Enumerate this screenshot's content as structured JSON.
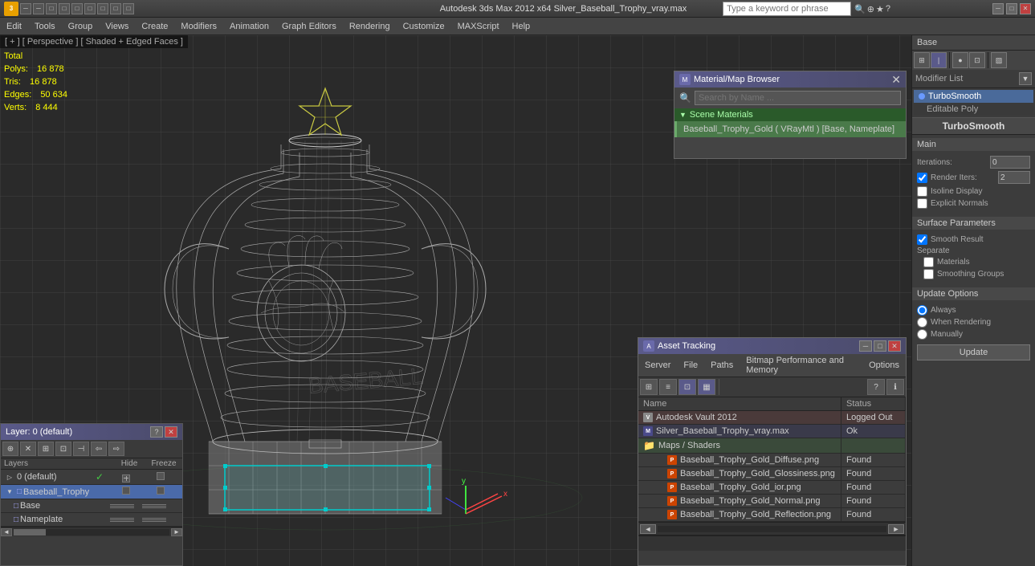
{
  "window": {
    "title": "Autodesk 3ds Max  2012 x64    Silver_Baseball_Trophy_vray.max",
    "app_icon": "3",
    "search_placeholder": "Type a keyword or phrase",
    "min_btn": "─",
    "max_btn": "□",
    "close_btn": "✕"
  },
  "titlebar": {
    "left_buttons": [
      "─",
      "─",
      "□",
      "□",
      "□",
      "□",
      "□",
      "□",
      "□"
    ]
  },
  "menubar": {
    "items": [
      "Edit",
      "Tools",
      "Group",
      "Views",
      "Create",
      "Modifiers",
      "Animation",
      "Graph Editors",
      "Rendering",
      "Customize",
      "MAXScript",
      "Help"
    ]
  },
  "viewport": {
    "label": "[ + ] [ Perspective ] [ Shaded + Edged Faces ]",
    "stats": {
      "total_label": "Total",
      "polys_label": "Polys:",
      "polys_val": "16 878",
      "tris_label": "Tris:",
      "tris_val": "16 878",
      "edges_label": "Edges:",
      "edges_val": "50 634",
      "verts_label": "Verts:",
      "verts_val": "8 444"
    }
  },
  "material_browser": {
    "title": "Material/Map Browser",
    "search_placeholder": "Search by Name ...",
    "section_label": "Scene Materials",
    "mat_item": "Baseball_Trophy_Gold ( VRayMtl ) [Base, Nameplate]"
  },
  "asset_tracking": {
    "title": "Asset Tracking",
    "menu_items": [
      "Server",
      "File",
      "Paths",
      "Bitmap Performance and Memory",
      "Options"
    ],
    "toolbar_buttons": [
      "⊞",
      "≡",
      "⊡",
      "▦"
    ],
    "help_btn": "?",
    "columns": {
      "name": "Name",
      "status": "Status"
    },
    "rows": [
      {
        "indent": 0,
        "icon": "vault",
        "name": "Autodesk Vault 2012",
        "status": "Logged Out",
        "status_class": "status-loggedout"
      },
      {
        "indent": 1,
        "icon": "max",
        "name": "Silver_Baseball_Trophy_vray.max",
        "status": "Ok",
        "status_class": "status-ok"
      },
      {
        "indent": 2,
        "icon": "folder",
        "name": "Maps / Shaders",
        "status": "",
        "status_class": ""
      },
      {
        "indent": 3,
        "icon": "png",
        "name": "Baseball_Trophy_Gold_Diffuse.png",
        "status": "Found",
        "status_class": "status-found"
      },
      {
        "indent": 3,
        "icon": "png",
        "name": "Baseball_Trophy_Gold_Glossiness.png",
        "status": "Found",
        "status_class": "status-found"
      },
      {
        "indent": 3,
        "icon": "png",
        "name": "Baseball_Trophy_Gold_ior.png",
        "status": "Found",
        "status_class": "status-found"
      },
      {
        "indent": 3,
        "icon": "png",
        "name": "Baseball_Trophy_Gold_Normal.png",
        "status": "Found",
        "status_class": "status-found"
      },
      {
        "indent": 3,
        "icon": "png",
        "name": "Baseball_Trophy_Gold_Reflection.png",
        "status": "Found",
        "status_class": "status-found"
      }
    ]
  },
  "layer_panel": {
    "title": "Layer: 0 (default)",
    "help_btn": "?",
    "close_btn": "✕",
    "toolbar_buttons": [
      "⊕",
      "✕",
      "⊞",
      "⊡",
      "⊣",
      "⇦",
      "⇨"
    ],
    "columns": {
      "layers": "Layers",
      "hide": "Hide",
      "freeze": "Freeze"
    },
    "layers": [
      {
        "indent": 0,
        "name": "0 (default)",
        "active": true,
        "checked": true
      },
      {
        "indent": 0,
        "name": "Baseball_Trophy",
        "active": true,
        "selected": true
      },
      {
        "indent": 1,
        "name": "Base",
        "active": false
      },
      {
        "indent": 1,
        "name": "Nameplate",
        "active": false
      }
    ]
  },
  "right_panel": {
    "modifier_list_label": "Modifier List",
    "modifiers": [
      {
        "name": "TurboSmooth",
        "active": true
      },
      {
        "name": "Editable Poly",
        "active": false
      }
    ],
    "section_main": "Main",
    "iterations_label": "Iterations:",
    "iterations_val": "0",
    "render_iters_label": "Render Iters:",
    "render_iters_val": "2",
    "render_iters_checked": true,
    "isoline_label": "Isoline Display",
    "explicit_normals_label": "Explicit Normals",
    "section_surface": "Surface Parameters",
    "smooth_result_label": "Smooth Result",
    "smooth_result_checked": true,
    "separate_label": "Separate",
    "materials_label": "Materials",
    "smoothing_groups_label": "Smoothing Groups",
    "update_options_label": "Update Options",
    "always_label": "Always",
    "when_rendering_label": "When Rendering",
    "manually_label": "Manually",
    "update_btn": "Update",
    "panel_title": "TurboSmooth",
    "base_label": "Base"
  }
}
